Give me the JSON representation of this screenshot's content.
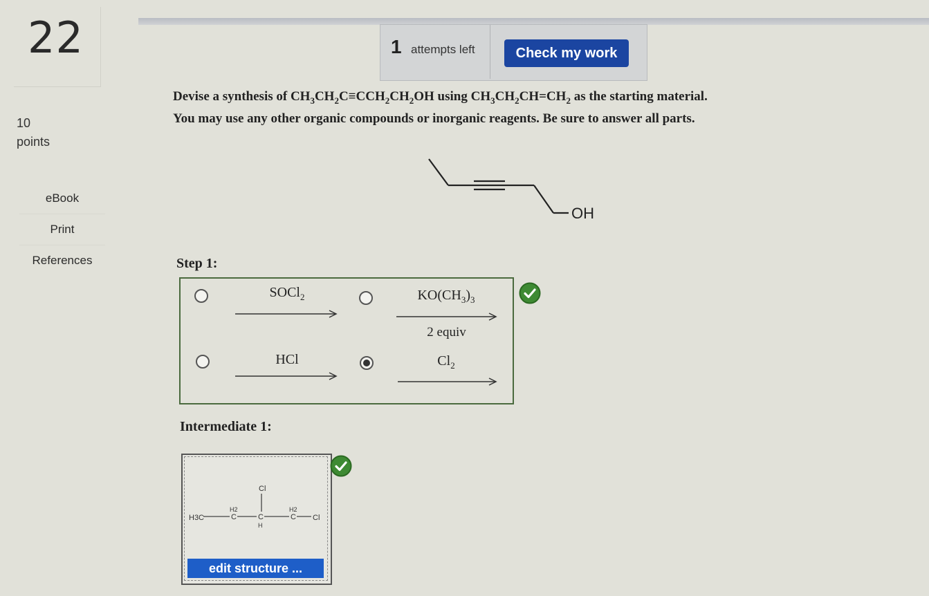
{
  "question": {
    "number": "22",
    "points_value": "10",
    "points_label": "points"
  },
  "side_nav": {
    "items": [
      {
        "label": "eBook"
      },
      {
        "label": "Print"
      },
      {
        "label": "References"
      }
    ]
  },
  "attempts": {
    "count": "1",
    "text": "attempts left",
    "check_button": "Check my work"
  },
  "prompt": {
    "line1_prefix": "Devise a synthesis of ",
    "target_formula": "CH3CH2C≡CCH2CH2OH",
    "line1_mid": " using ",
    "start_formula": "CH3CH2CH=CH2",
    "line1_suffix": " as the starting material.",
    "line2": "You may use any other organic compounds or inorganic reagents. Be sure to answer all parts."
  },
  "target_molecule": {
    "oh_label": "OH"
  },
  "step1": {
    "label": "Step 1:",
    "options": [
      {
        "reagent": "SOCl2",
        "selected": false
      },
      {
        "reagent": "KO(CH3)3",
        "condition": "2 equiv",
        "selected": false
      },
      {
        "reagent": "HCl",
        "selected": false
      },
      {
        "reagent": "Cl2",
        "selected": true
      }
    ],
    "status": "correct"
  },
  "intermediate1": {
    "label": "Intermediate 1:",
    "structure_labels": {
      "h3c": "H3C",
      "h2_left": "H2",
      "c_left": "C",
      "cl_top": "Cl",
      "c_mid": "C",
      "h_mid": "H",
      "h2_right": "H2",
      "c_right": "C",
      "cl_right": "Cl"
    },
    "edit_button": "edit structure ...",
    "status": "correct"
  },
  "colors": {
    "primary_button": "#1b45a1",
    "edit_button": "#1e5ec8",
    "correct_badge": "#3e8a33",
    "background": "#e1e1d9"
  }
}
